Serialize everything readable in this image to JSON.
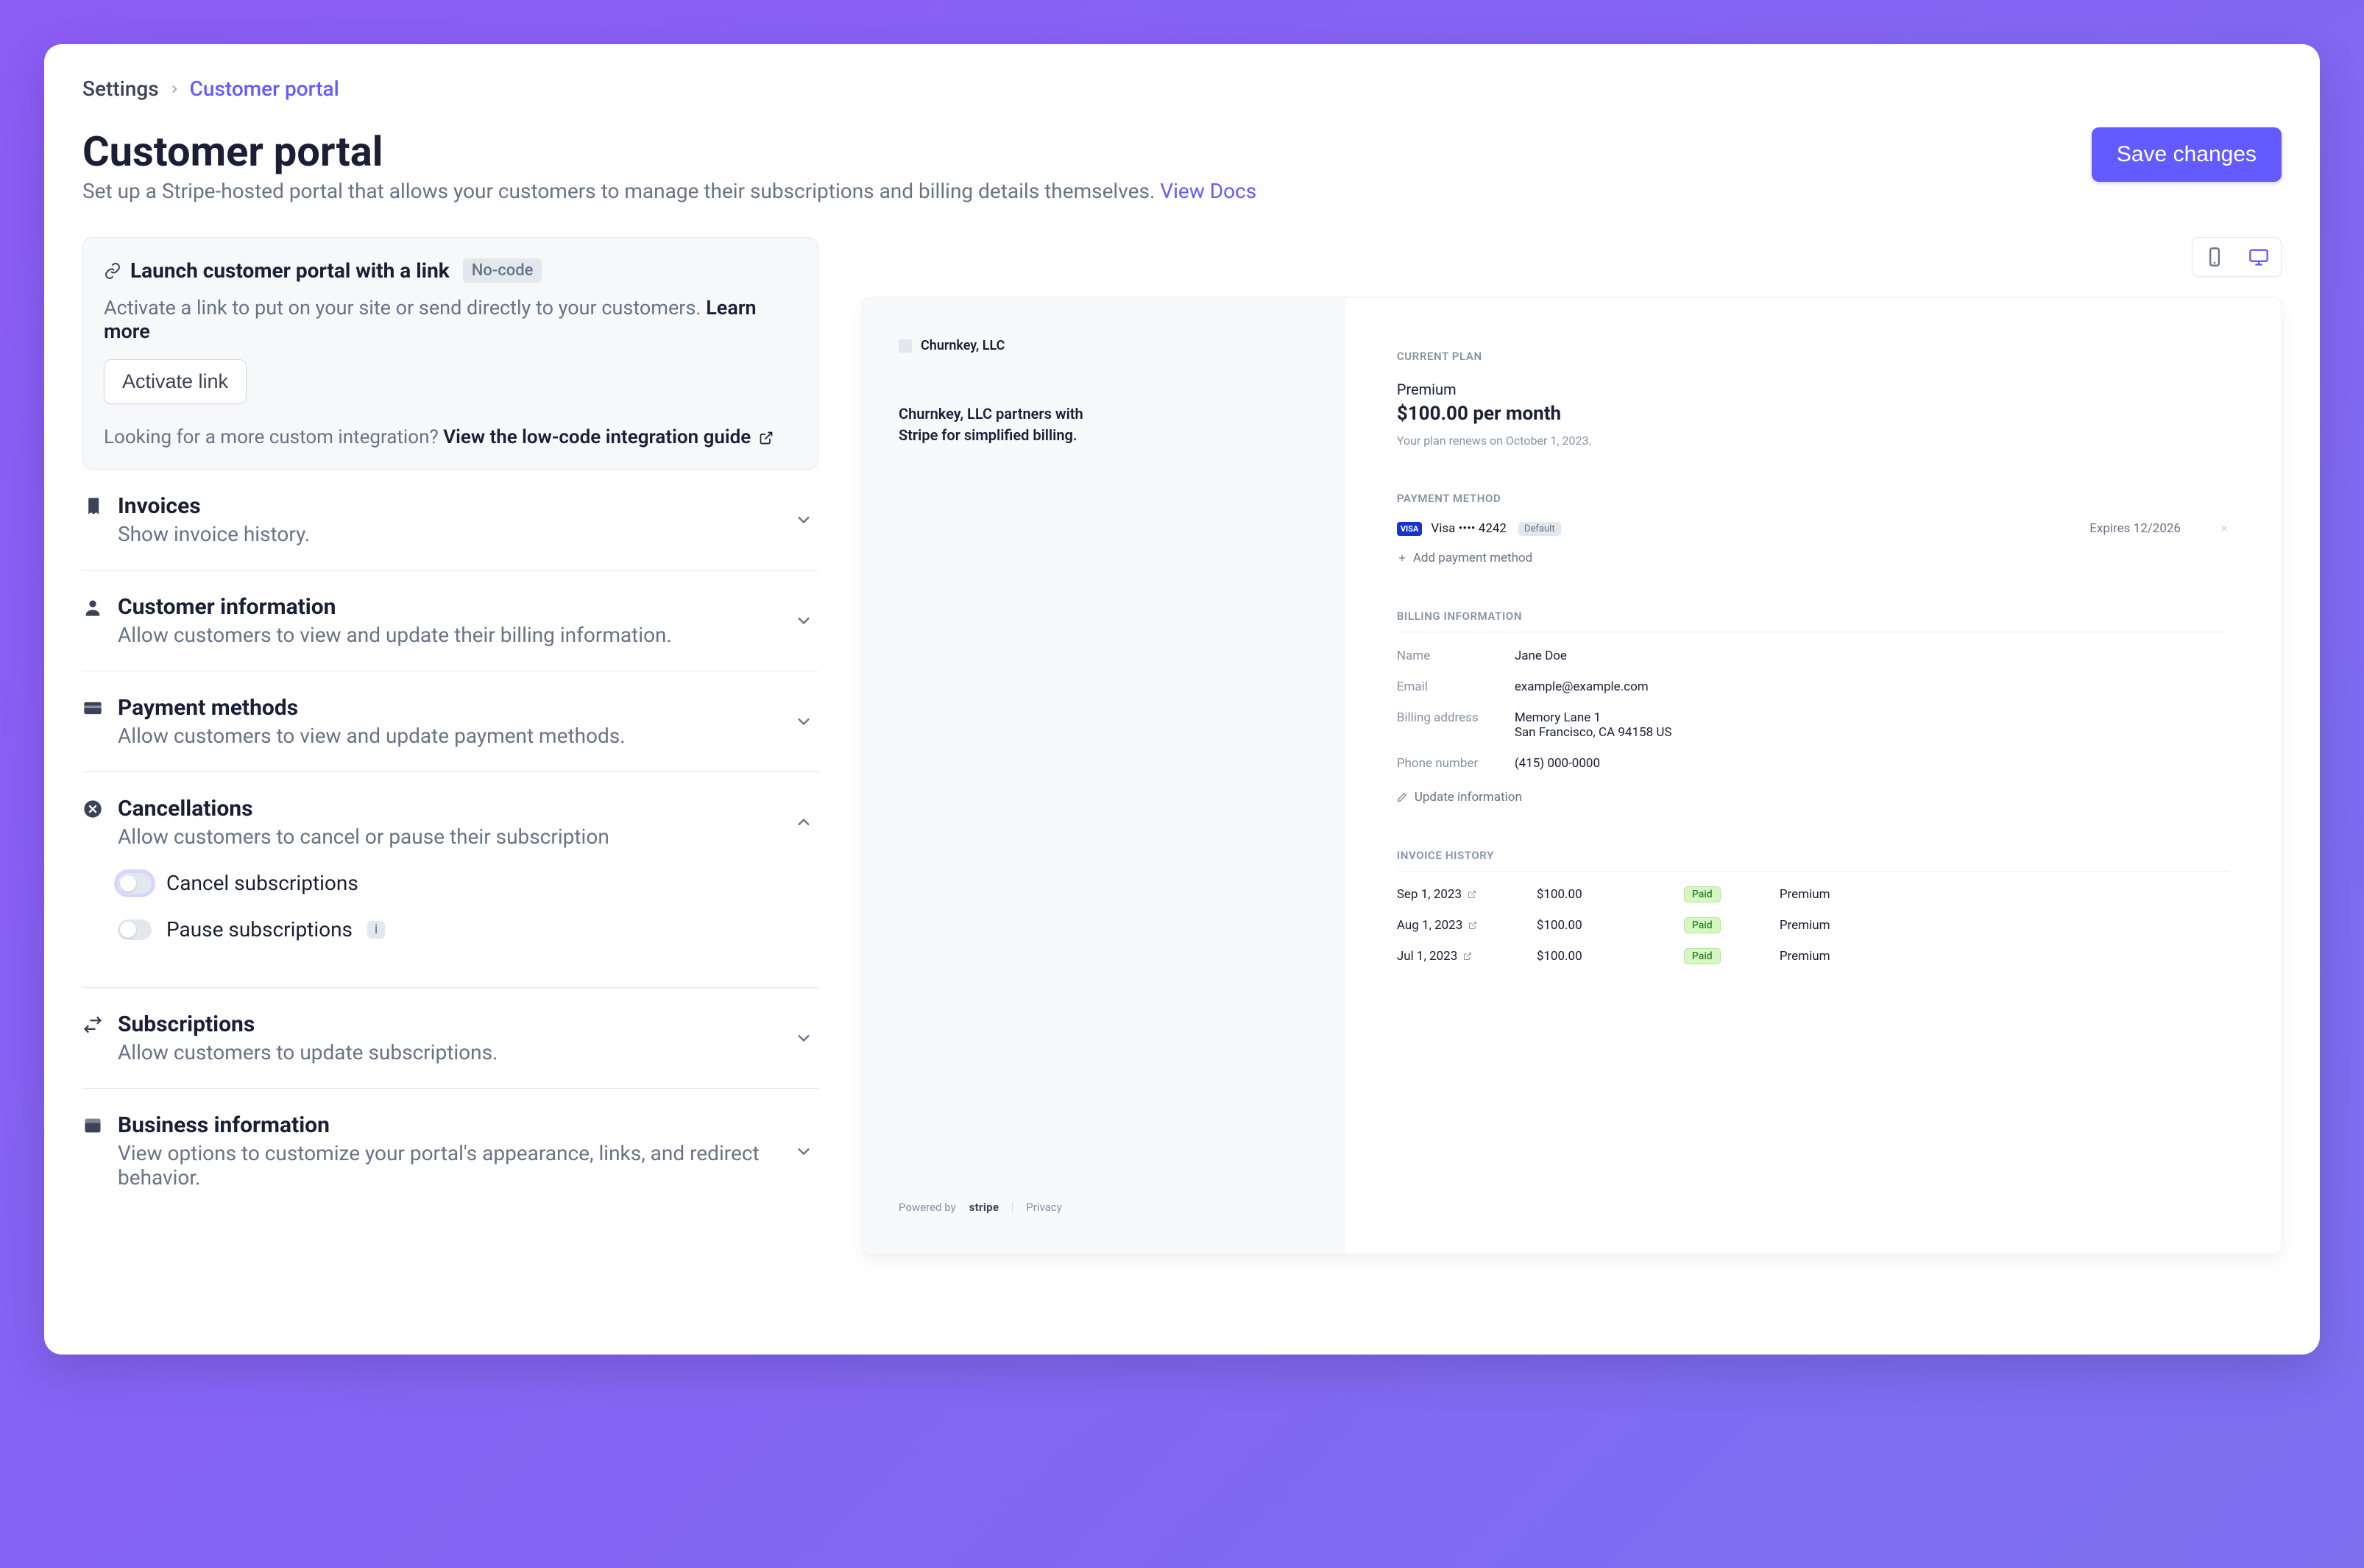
{
  "breadcrumb": {
    "root": "Settings",
    "current": "Customer portal"
  },
  "header": {
    "title": "Customer portal",
    "subtitle": "Set up a Stripe-hosted portal that allows your customers to manage their subscriptions and billing details themselves. ",
    "docs_link": "View Docs",
    "save_label": "Save changes"
  },
  "launch": {
    "title": "Launch customer portal with a link",
    "badge": "No-code",
    "subtitle": "Activate a link to put on your site or send directly to your customers. ",
    "learn_more": "Learn more",
    "activate_label": "Activate link",
    "lowcode_q": "Looking for a more custom integration? ",
    "lowcode_link": "View the low-code integration guide"
  },
  "sections": {
    "invoices": {
      "title": "Invoices",
      "desc": "Show invoice history."
    },
    "customer_info": {
      "title": "Customer information",
      "desc": "Allow customers to view and update their billing information."
    },
    "payment_methods": {
      "title": "Payment methods",
      "desc": "Allow customers to view and update payment methods."
    },
    "cancellations": {
      "title": "Cancellations",
      "desc": "Allow customers to cancel or pause their subscription",
      "cancel_toggle": "Cancel subscriptions",
      "pause_toggle": "Pause subscriptions"
    },
    "subscriptions": {
      "title": "Subscriptions",
      "desc": "Allow customers to update subscriptions."
    },
    "business_info": {
      "title": "Business information",
      "desc": "View options to customize your portal's appearance, links, and redirect behavior."
    }
  },
  "preview": {
    "business_name": "Churnkey, LLC",
    "business_message": "Churnkey, LLC partners with Stripe for simplified billing.",
    "footer": {
      "powered_by": "Powered by",
      "brand": "stripe",
      "privacy": "Privacy"
    },
    "current_plan": {
      "label": "CURRENT PLAN",
      "name": "Premium",
      "price": "$100.00 per month",
      "renewal": "Your plan renews on October 1, 2023."
    },
    "payment_method": {
      "label": "PAYMENT METHOD",
      "brand": "VISA",
      "text": "Visa •••• 4242",
      "default_badge": "Default",
      "expires": "Expires 12/2026",
      "add_label": "Add payment method"
    },
    "billing_info": {
      "label": "BILLING INFORMATION",
      "name_k": "Name",
      "name_v": "Jane Doe",
      "email_k": "Email",
      "email_v": "example@example.com",
      "addr_k": "Billing address",
      "addr_v1": "Memory Lane 1",
      "addr_v2": "San Francisco, CA 94158 US",
      "phone_k": "Phone number",
      "phone_v": "(415) 000-0000",
      "update_label": "Update information"
    },
    "invoice_history": {
      "label": "INVOICE HISTORY",
      "rows": [
        {
          "date": "Sep 1, 2023",
          "amount": "$100.00",
          "status": "Paid",
          "product": "Premium"
        },
        {
          "date": "Aug 1, 2023",
          "amount": "$100.00",
          "status": "Paid",
          "product": "Premium"
        },
        {
          "date": "Jul 1, 2023",
          "amount": "$100.00",
          "status": "Paid",
          "product": "Premium"
        }
      ]
    }
  }
}
